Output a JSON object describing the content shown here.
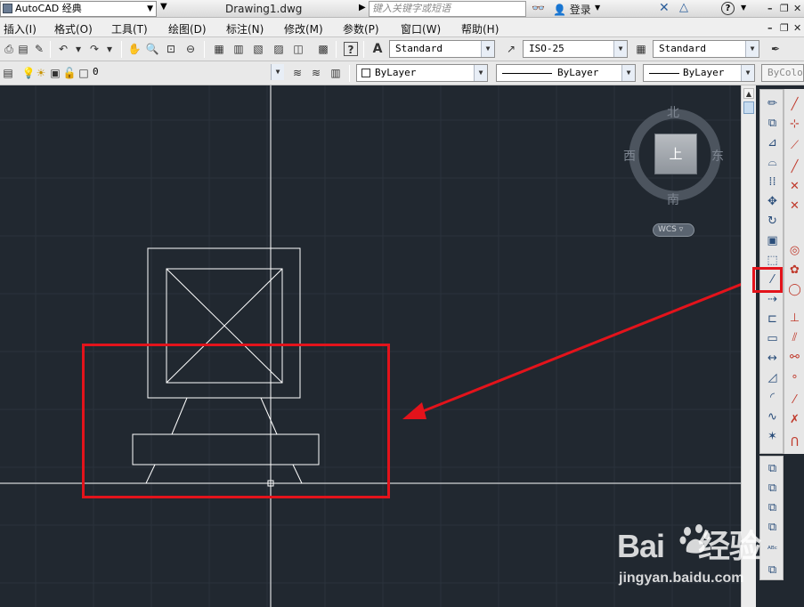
{
  "titlebar": {
    "workspace": "AutoCAD 经典",
    "document_title": "Drawing1.dwg",
    "search_placeholder": "键入关键字或短语",
    "login_label": "登录"
  },
  "menu": {
    "items": [
      "插入(I)",
      "格式(O)",
      "工具(T)",
      "绘图(D)",
      "标注(N)",
      "修改(M)",
      "参数(P)",
      "窗口(W)",
      "帮助(H)"
    ]
  },
  "styles_toolbar": {
    "text_style": "Standard",
    "dim_style": "ISO-25",
    "table_style": "Standard"
  },
  "layers_toolbar": {
    "current_layer": "0",
    "color": "ByLayer",
    "linetype": "ByLayer",
    "lineweight": "ByLayer",
    "plotstyle": "ByColor"
  },
  "viewcube": {
    "north": "北",
    "south": "南",
    "east": "东",
    "west": "西",
    "face": "上",
    "wcs_label": "WCS"
  },
  "icons": {
    "highlighted_tool": "extend-icon"
  },
  "colors": {
    "canvas_bg": "#212830",
    "annotation_red": "#e3131b",
    "crosshair": "#ffffff"
  },
  "watermark": {
    "logo_left": "Bai",
    "logo_right": "经验",
    "url": "jingyan.baidu.com"
  }
}
